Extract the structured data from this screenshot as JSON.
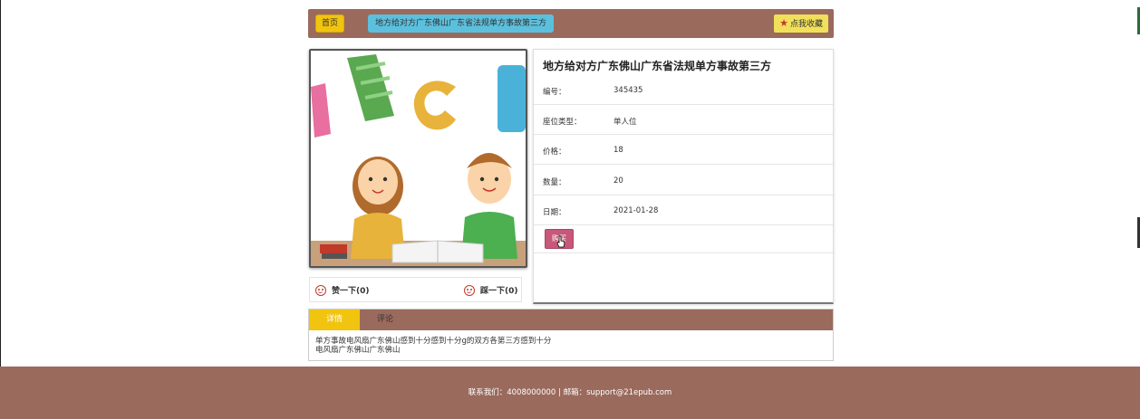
{
  "header": {
    "home_label": "首页",
    "breadcrumb": "地方给对方广东佛山广东省法规单方事故第三方",
    "favorite_label": "点我收藏"
  },
  "product": {
    "title": "地方给对方广东佛山广东省法规单方事故第三方",
    "fields": [
      {
        "label": "编号：",
        "value": "345435"
      },
      {
        "label": "座位类型：",
        "value": "单人位"
      },
      {
        "label": "价格：",
        "value": "18"
      },
      {
        "label": "数量：",
        "value": "20"
      },
      {
        "label": "日期：",
        "value": "2021-01-28"
      }
    ],
    "buy_label": "购买"
  },
  "votes": {
    "like": "赞一下(0)",
    "dislike": "踩一下(0)"
  },
  "tabs": {
    "details": "详情",
    "comments": "评论",
    "description_line1": "单方事故电风扇广东佛山感到十分感到十分g的双方各第三方感到十分",
    "description_line2": "电风扇广东佛山广东佛山"
  },
  "footer": {
    "contact": "联系我们：4008000000 | 邮箱：support@21epub.com"
  },
  "colors": {
    "brand_brown": "#9a6a5d",
    "yellow": "#f1c40f",
    "cyan": "#5bc0de",
    "buy_pink": "#c7587a"
  }
}
